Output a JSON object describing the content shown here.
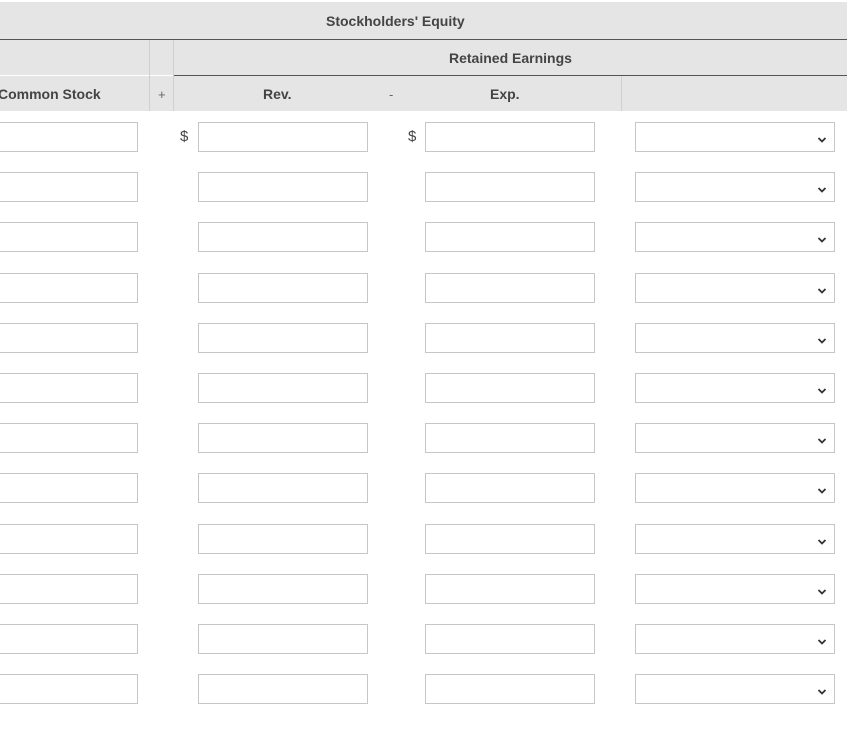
{
  "header": {
    "title": "Stockholders' Equity",
    "retained_earnings": "Retained Earnings",
    "common_stock": "Common Stock",
    "plus": "+",
    "rev": "Rev.",
    "minus": "-",
    "exp": "Exp."
  },
  "currency_symbol": "$",
  "rows": [
    {
      "common_stock": "",
      "rev": "",
      "exp": "",
      "select": ""
    },
    {
      "common_stock": "",
      "rev": "",
      "exp": "",
      "select": ""
    },
    {
      "common_stock": "",
      "rev": "",
      "exp": "",
      "select": ""
    },
    {
      "common_stock": "",
      "rev": "",
      "exp": "",
      "select": ""
    },
    {
      "common_stock": "",
      "rev": "",
      "exp": "",
      "select": ""
    },
    {
      "common_stock": "",
      "rev": "",
      "exp": "",
      "select": ""
    },
    {
      "common_stock": "",
      "rev": "",
      "exp": "",
      "select": ""
    },
    {
      "common_stock": "",
      "rev": "",
      "exp": "",
      "select": ""
    },
    {
      "common_stock": "",
      "rev": "",
      "exp": "",
      "select": ""
    },
    {
      "common_stock": "",
      "rev": "",
      "exp": "",
      "select": ""
    },
    {
      "common_stock": "",
      "rev": "",
      "exp": "",
      "select": ""
    },
    {
      "common_stock": "",
      "rev": "",
      "exp": "",
      "select": ""
    }
  ],
  "icons": {
    "dropdown": "chevron-down-icon"
  }
}
